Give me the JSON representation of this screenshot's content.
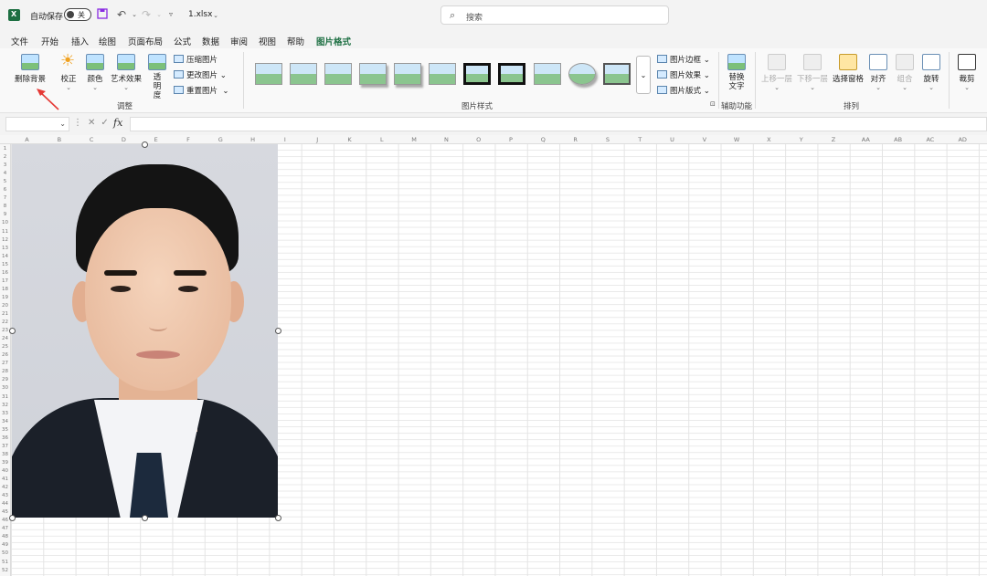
{
  "titlebar": {
    "autosave_label": "自动保存",
    "autosave_state": "关",
    "filename": "1.xlsx",
    "search_placeholder": "搜索"
  },
  "tabs": [
    "文件",
    "开始",
    "插入",
    "绘图",
    "页面布局",
    "公式",
    "数据",
    "审阅",
    "视图",
    "帮助",
    "图片格式"
  ],
  "active_tab": "图片格式",
  "ribbon": {
    "adjust": {
      "remove_bg": "删除背景",
      "correct": "校正",
      "color": "颜色",
      "artistic": "艺术效果",
      "transparency": "透明度",
      "compress": "压缩图片",
      "change": "更改图片",
      "reset": "重置图片",
      "group": "调整"
    },
    "styles": {
      "group": "图片样式",
      "border": "图片边框",
      "effects": "图片效果",
      "layout": "图片版式"
    },
    "accessibility": {
      "alt_text": "替换文字",
      "group": "辅助功能"
    },
    "arrange": {
      "bring_forward": "上移一层",
      "send_backward": "下移一层",
      "selection_pane": "选择窗格",
      "align": "对齐",
      "group_btn": "组合",
      "rotate": "旋转",
      "group": "排列"
    },
    "size": {
      "crop": "裁剪"
    }
  },
  "formula_bar": {
    "fx": "fx",
    "value": ""
  },
  "columns": [
    "A",
    "B",
    "C",
    "D",
    "E",
    "F",
    "G",
    "H",
    "I",
    "J",
    "K",
    "L",
    "M",
    "N",
    "O",
    "P",
    "Q",
    "R",
    "S",
    "T",
    "U",
    "V",
    "W",
    "X",
    "Y",
    "Z",
    "AA",
    "AB",
    "AC",
    "AD"
  ],
  "rows": [
    "1",
    "2",
    "3",
    "4",
    "5",
    "6",
    "7",
    "8",
    "9",
    "10",
    "11",
    "12",
    "13",
    "14",
    "15",
    "16",
    "17",
    "18",
    "19",
    "20",
    "21",
    "22",
    "23",
    "24",
    "25",
    "26",
    "27",
    "28",
    "29",
    "30",
    "31",
    "32",
    "33",
    "34",
    "35",
    "36",
    "37",
    "38",
    "39",
    "40",
    "41",
    "42",
    "43",
    "44",
    "45",
    "46",
    "47",
    "48",
    "49",
    "50",
    "51",
    "52"
  ],
  "colors": {
    "accent": "#1d6f42",
    "arrow": "#e53935"
  }
}
